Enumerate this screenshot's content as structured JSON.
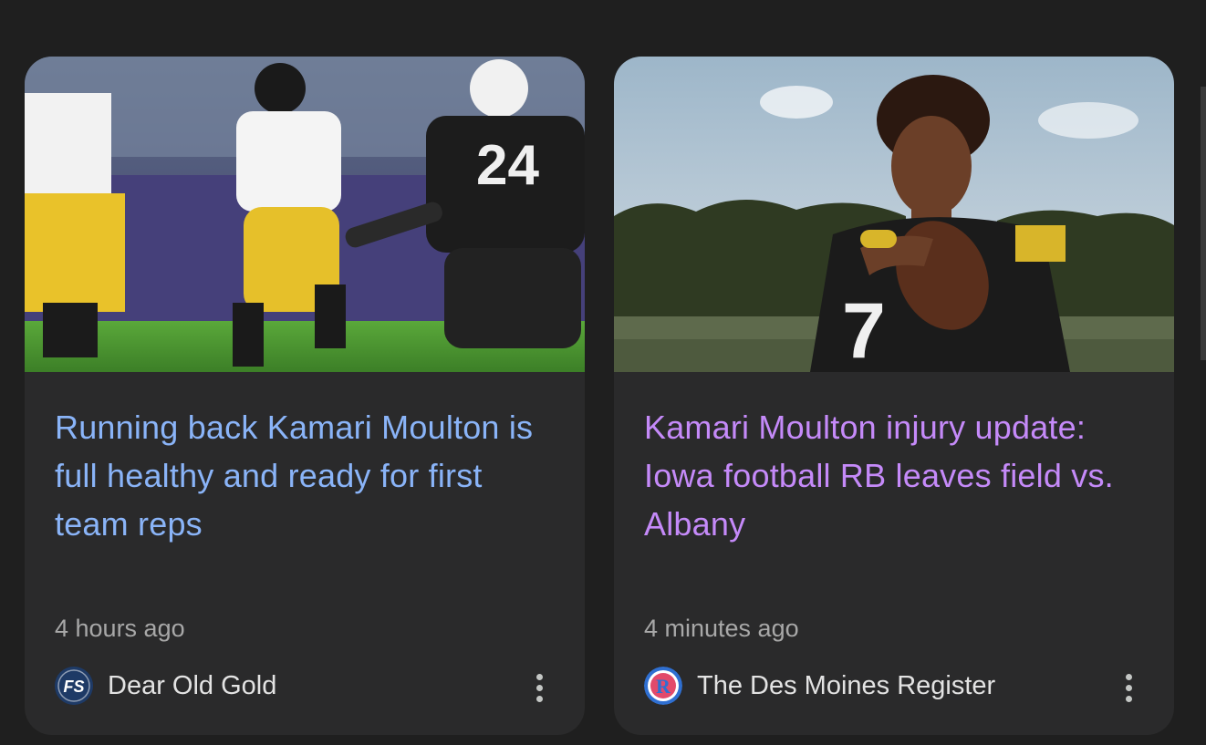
{
  "cards": [
    {
      "headline": "Running back Kamari Moulton is full healthy and ready for first team reps",
      "time": "4 hours ago",
      "source": "Dear Old Gold",
      "logo_text": "FS",
      "thumbnail": "football-action-photo",
      "headline_color": "#8ab4f8"
    },
    {
      "headline": "Kamari Moulton injury update: Iowa football RB leaves field vs. Albany",
      "time": "4 minutes ago",
      "source": "The Des Moines Register",
      "logo_text": "R",
      "thumbnail": "player-portrait-photo",
      "headline_color": "#c58af9"
    }
  ],
  "icons": {
    "more": "more-vert-icon"
  }
}
